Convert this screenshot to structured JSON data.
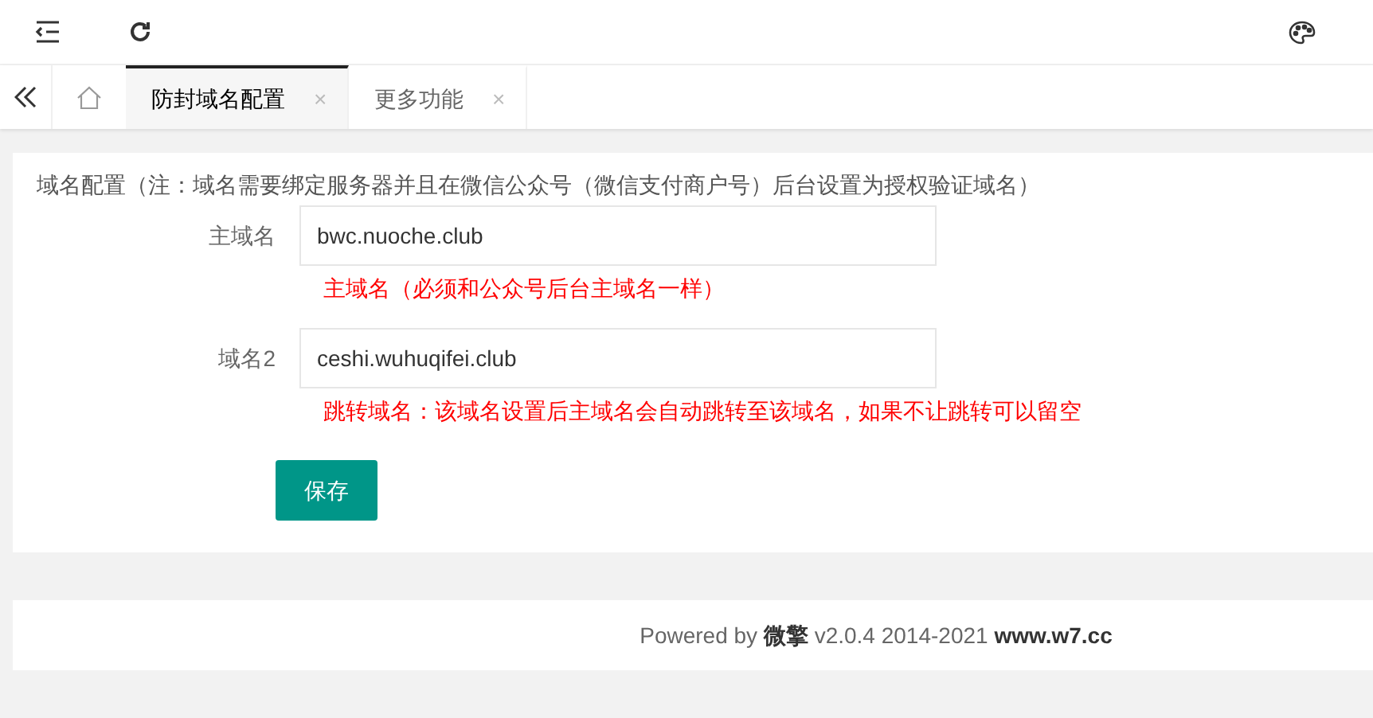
{
  "tabs": [
    {
      "label": "防封域名配置",
      "selected": true,
      "close": "×"
    },
    {
      "label": "更多功能",
      "selected": false,
      "close": "×"
    }
  ],
  "form": {
    "title": "域名配置（注：域名需要绑定服务器并且在微信公众号（微信支付商户号）后台设置为授权验证域名）",
    "fields": [
      {
        "label": "主域名",
        "value": "bwc.nuoche.club",
        "hint": "主域名（必须和公众号后台主域名一样）"
      },
      {
        "label": "域名2",
        "value": "ceshi.wuhuqifei.club",
        "hint": "跳转域名：该域名设置后主域名会自动跳转至该域名，如果不让跳转可以留空"
      }
    ],
    "button": "保存"
  },
  "footer": "Powered by **微擎** v2.0.4 2014-2021 **www.w7.cc**"
}
